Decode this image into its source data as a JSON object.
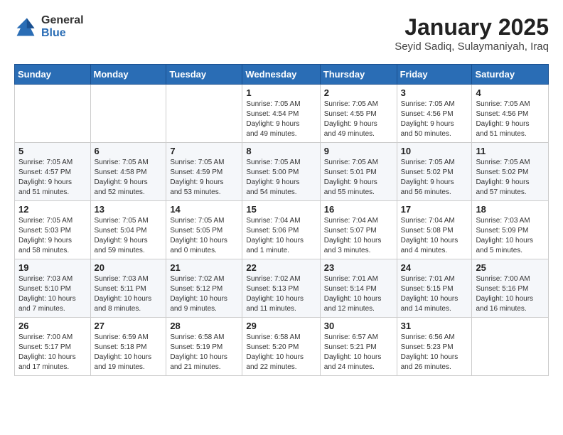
{
  "header": {
    "logo_general": "General",
    "logo_blue": "Blue",
    "title": "January 2025",
    "subtitle": "Seyid Sadiq, Sulaymaniyah, Iraq"
  },
  "days_of_week": [
    "Sunday",
    "Monday",
    "Tuesday",
    "Wednesday",
    "Thursday",
    "Friday",
    "Saturday"
  ],
  "weeks": [
    [
      {
        "day": "",
        "info": ""
      },
      {
        "day": "",
        "info": ""
      },
      {
        "day": "",
        "info": ""
      },
      {
        "day": "1",
        "info": "Sunrise: 7:05 AM\nSunset: 4:54 PM\nDaylight: 9 hours\nand 49 minutes."
      },
      {
        "day": "2",
        "info": "Sunrise: 7:05 AM\nSunset: 4:55 PM\nDaylight: 9 hours\nand 49 minutes."
      },
      {
        "day": "3",
        "info": "Sunrise: 7:05 AM\nSunset: 4:56 PM\nDaylight: 9 hours\nand 50 minutes."
      },
      {
        "day": "4",
        "info": "Sunrise: 7:05 AM\nSunset: 4:56 PM\nDaylight: 9 hours\nand 51 minutes."
      }
    ],
    [
      {
        "day": "5",
        "info": "Sunrise: 7:05 AM\nSunset: 4:57 PM\nDaylight: 9 hours\nand 51 minutes."
      },
      {
        "day": "6",
        "info": "Sunrise: 7:05 AM\nSunset: 4:58 PM\nDaylight: 9 hours\nand 52 minutes."
      },
      {
        "day": "7",
        "info": "Sunrise: 7:05 AM\nSunset: 4:59 PM\nDaylight: 9 hours\nand 53 minutes."
      },
      {
        "day": "8",
        "info": "Sunrise: 7:05 AM\nSunset: 5:00 PM\nDaylight: 9 hours\nand 54 minutes."
      },
      {
        "day": "9",
        "info": "Sunrise: 7:05 AM\nSunset: 5:01 PM\nDaylight: 9 hours\nand 55 minutes."
      },
      {
        "day": "10",
        "info": "Sunrise: 7:05 AM\nSunset: 5:02 PM\nDaylight: 9 hours\nand 56 minutes."
      },
      {
        "day": "11",
        "info": "Sunrise: 7:05 AM\nSunset: 5:02 PM\nDaylight: 9 hours\nand 57 minutes."
      }
    ],
    [
      {
        "day": "12",
        "info": "Sunrise: 7:05 AM\nSunset: 5:03 PM\nDaylight: 9 hours\nand 58 minutes."
      },
      {
        "day": "13",
        "info": "Sunrise: 7:05 AM\nSunset: 5:04 PM\nDaylight: 9 hours\nand 59 minutes."
      },
      {
        "day": "14",
        "info": "Sunrise: 7:05 AM\nSunset: 5:05 PM\nDaylight: 10 hours\nand 0 minutes."
      },
      {
        "day": "15",
        "info": "Sunrise: 7:04 AM\nSunset: 5:06 PM\nDaylight: 10 hours\nand 1 minute."
      },
      {
        "day": "16",
        "info": "Sunrise: 7:04 AM\nSunset: 5:07 PM\nDaylight: 10 hours\nand 3 minutes."
      },
      {
        "day": "17",
        "info": "Sunrise: 7:04 AM\nSunset: 5:08 PM\nDaylight: 10 hours\nand 4 minutes."
      },
      {
        "day": "18",
        "info": "Sunrise: 7:03 AM\nSunset: 5:09 PM\nDaylight: 10 hours\nand 5 minutes."
      }
    ],
    [
      {
        "day": "19",
        "info": "Sunrise: 7:03 AM\nSunset: 5:10 PM\nDaylight: 10 hours\nand 7 minutes."
      },
      {
        "day": "20",
        "info": "Sunrise: 7:03 AM\nSunset: 5:11 PM\nDaylight: 10 hours\nand 8 minutes."
      },
      {
        "day": "21",
        "info": "Sunrise: 7:02 AM\nSunset: 5:12 PM\nDaylight: 10 hours\nand 9 minutes."
      },
      {
        "day": "22",
        "info": "Sunrise: 7:02 AM\nSunset: 5:13 PM\nDaylight: 10 hours\nand 11 minutes."
      },
      {
        "day": "23",
        "info": "Sunrise: 7:01 AM\nSunset: 5:14 PM\nDaylight: 10 hours\nand 12 minutes."
      },
      {
        "day": "24",
        "info": "Sunrise: 7:01 AM\nSunset: 5:15 PM\nDaylight: 10 hours\nand 14 minutes."
      },
      {
        "day": "25",
        "info": "Sunrise: 7:00 AM\nSunset: 5:16 PM\nDaylight: 10 hours\nand 16 minutes."
      }
    ],
    [
      {
        "day": "26",
        "info": "Sunrise: 7:00 AM\nSunset: 5:17 PM\nDaylight: 10 hours\nand 17 minutes."
      },
      {
        "day": "27",
        "info": "Sunrise: 6:59 AM\nSunset: 5:18 PM\nDaylight: 10 hours\nand 19 minutes."
      },
      {
        "day": "28",
        "info": "Sunrise: 6:58 AM\nSunset: 5:19 PM\nDaylight: 10 hours\nand 21 minutes."
      },
      {
        "day": "29",
        "info": "Sunrise: 6:58 AM\nSunset: 5:20 PM\nDaylight: 10 hours\nand 22 minutes."
      },
      {
        "day": "30",
        "info": "Sunrise: 6:57 AM\nSunset: 5:21 PM\nDaylight: 10 hours\nand 24 minutes."
      },
      {
        "day": "31",
        "info": "Sunrise: 6:56 AM\nSunset: 5:23 PM\nDaylight: 10 hours\nand 26 minutes."
      },
      {
        "day": "",
        "info": ""
      }
    ]
  ]
}
